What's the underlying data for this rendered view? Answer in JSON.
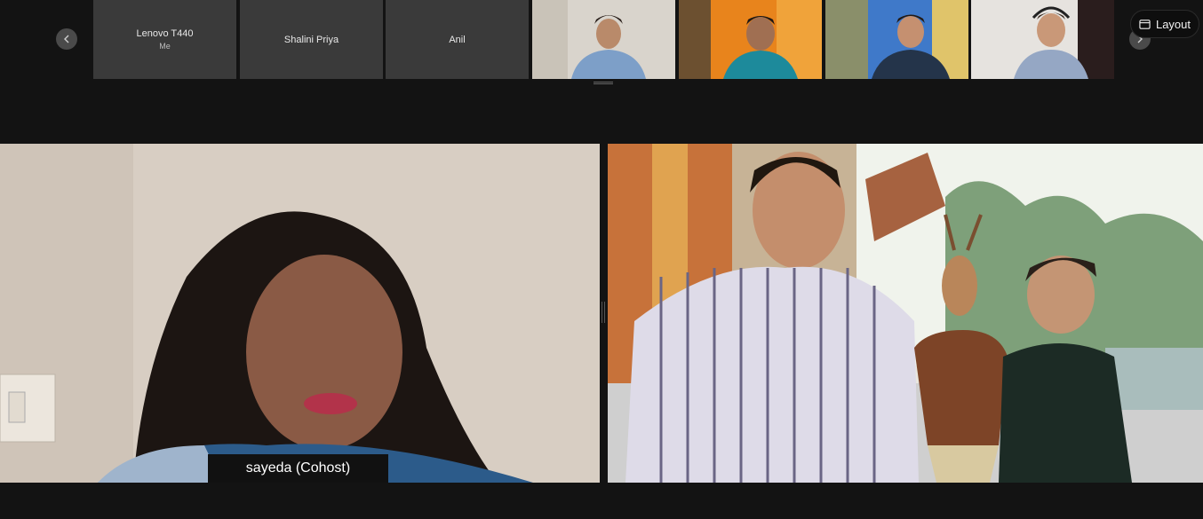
{
  "strip": {
    "tiles": [
      {
        "name": "Lenovo T440",
        "sub": "Me"
      },
      {
        "name": "Shalini Priya"
      },
      {
        "name": "Anil"
      }
    ]
  },
  "layout_button": {
    "label": "Layout",
    "icon": "layout-icon"
  },
  "main": {
    "left_participant_label": "sayeda (Cohost)"
  },
  "colors": {
    "background": "#131313",
    "tile": "#3a3a3a",
    "accent_orange": "#e8841c"
  }
}
